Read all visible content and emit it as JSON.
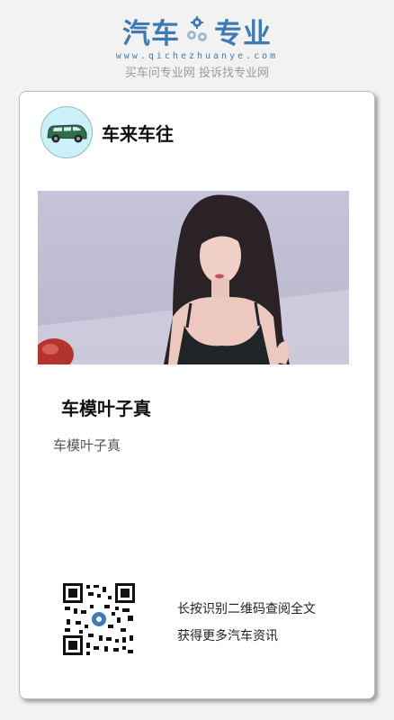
{
  "brand": {
    "name_left": "汽车",
    "name_right": "专业",
    "url": "www.qichezhuanye.com",
    "slogan": "买车问专业网 投诉找专业网",
    "color": "#3e7bb6"
  },
  "author": {
    "name": "车来车往",
    "avatar_icon": "car-icon"
  },
  "article": {
    "title": "车模叶子真",
    "summary": "车模叶子真"
  },
  "qr": {
    "line1": "长按识别二维码查阅全文",
    "line2": "获得更多汽车资讯"
  }
}
